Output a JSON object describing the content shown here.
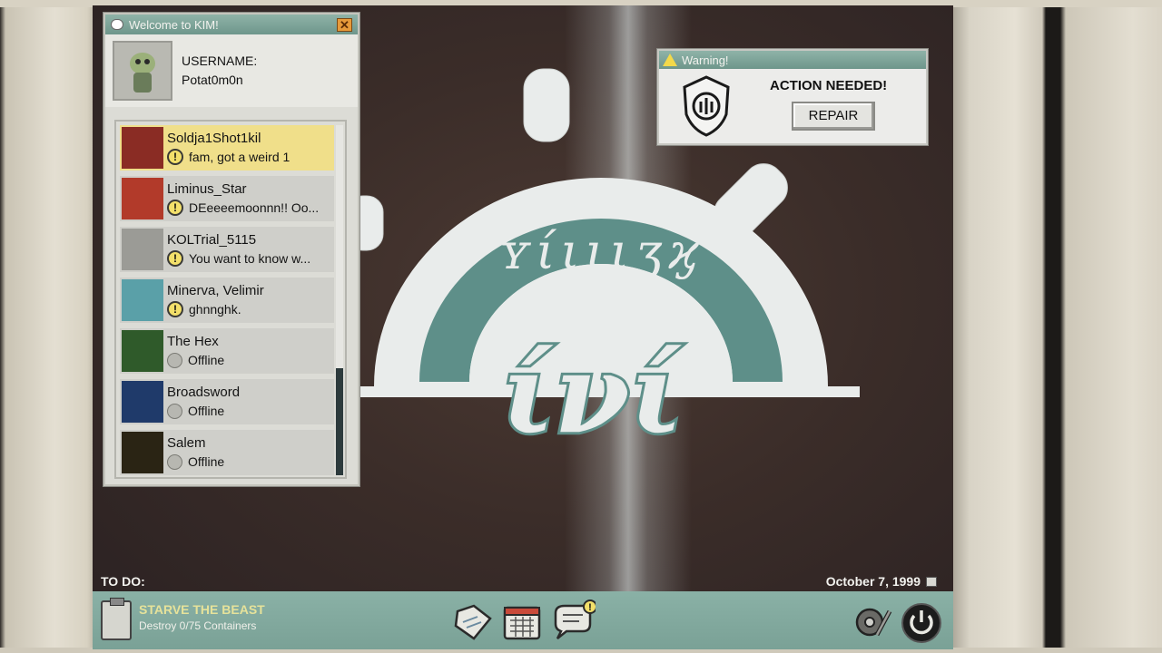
{
  "kim": {
    "title": "Welcome to KIM!",
    "close": "✕",
    "username_label": "USERNAME:",
    "username": "Potat0m0n",
    "contacts": [
      {
        "name": "Soldja1Shot1kil",
        "status": "fam, got a weird 1",
        "kind": "message",
        "active": true,
        "avatar_color": "#8a2c24"
      },
      {
        "name": "Liminus_Star",
        "status": "DEeeeemoonnn!! Oo...",
        "kind": "message",
        "active": false,
        "avatar_color": "#b23a2a"
      },
      {
        "name": "KOLTrial_5115",
        "status": "You want to know w...",
        "kind": "message",
        "active": false,
        "avatar_color": "#9b9b96"
      },
      {
        "name": "Minerva, Velimir",
        "status": "ghnnghk.",
        "kind": "message",
        "active": false,
        "avatar_color": "#5aa0a8"
      },
      {
        "name": "The Hex",
        "status": "Offline",
        "kind": "offline",
        "active": false,
        "avatar_color": "#2f5a2a"
      },
      {
        "name": "Broadsword",
        "status": "Offline",
        "kind": "offline",
        "active": false,
        "avatar_color": "#1f3a6a"
      },
      {
        "name": "Salem",
        "status": "Offline",
        "kind": "offline",
        "active": false,
        "avatar_color": "#2a2414"
      }
    ]
  },
  "warning": {
    "title": "Warning!",
    "heading": "ACTION NEEDED!",
    "button": "REPAIR"
  },
  "todo": {
    "label": "TO DO:",
    "task_title": "STARVE THE BEAST",
    "task_sub": "Destroy 0/75 Containers"
  },
  "date": "October 7, 1999",
  "logo": {
    "top_text": "ʏίιιιʒϗ",
    "center_text": "ίνί"
  },
  "colors": {
    "accent": "#7aa196",
    "highlight": "#f0df8a",
    "alert": "#f3e06a"
  }
}
